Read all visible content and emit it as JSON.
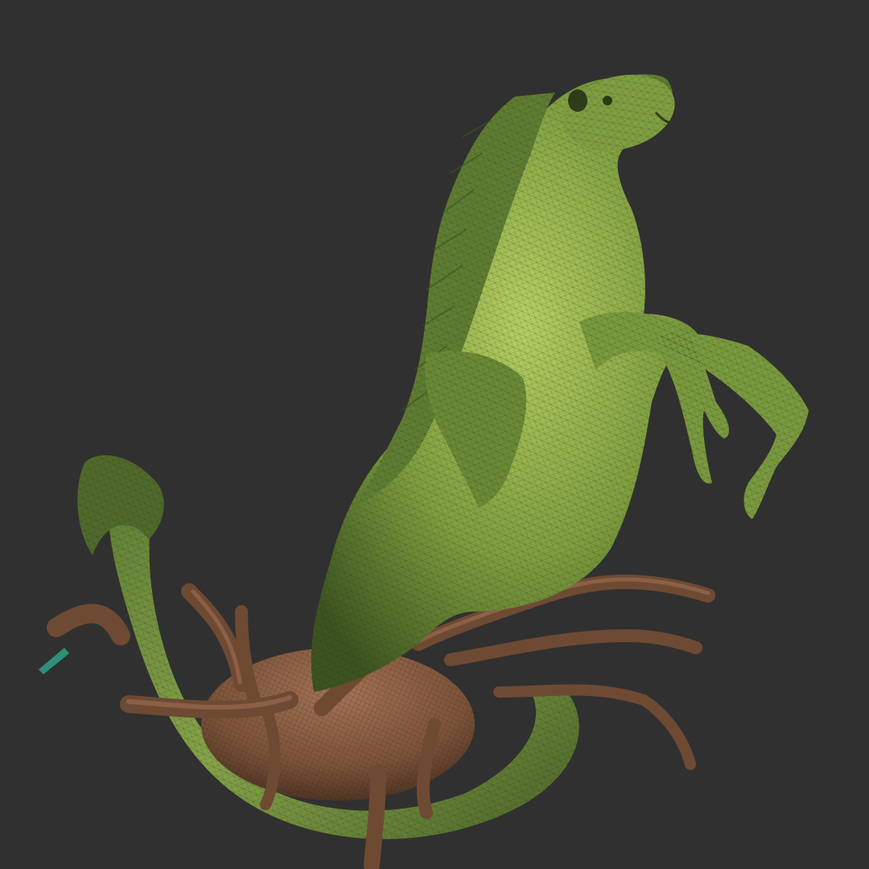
{
  "viewport": {
    "background_color": "#303030"
  },
  "model": {
    "body_color": "#6f8f3a",
    "body_highlight": "#a9c45a",
    "body_shadow": "#3d5420",
    "coral_color": "#7a5238",
    "coral_highlight": "#a47356",
    "coral_shadow": "#4a3024",
    "wireframe_color": "#1e2a10",
    "accent_color": "#2f8f7a"
  }
}
